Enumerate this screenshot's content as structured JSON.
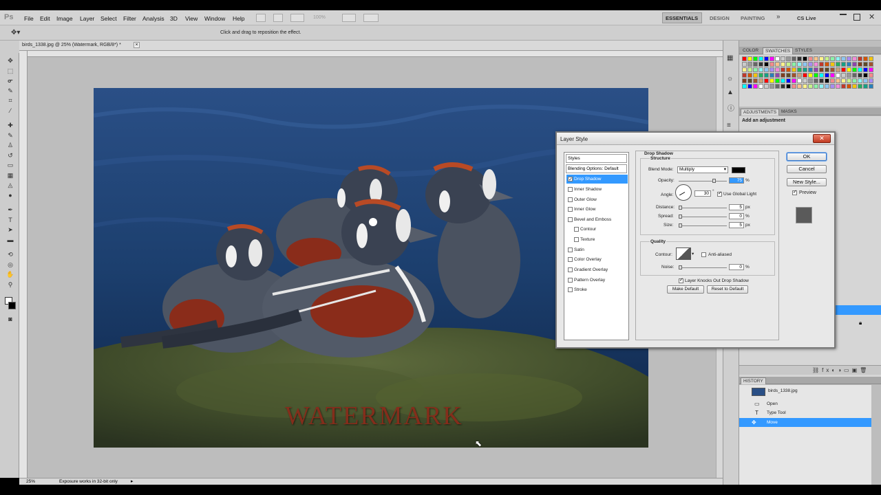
{
  "menubar": {
    "logo": "Ps",
    "items": [
      "File",
      "Edit",
      "Image",
      "Layer",
      "Select",
      "Filter",
      "Analysis",
      "3D",
      "View",
      "Window",
      "Help"
    ],
    "zoom": "100%",
    "workspaces": [
      "ESSENTIALS",
      "DESIGN",
      "PAINTING"
    ],
    "more": "»",
    "cslive": "CS Live"
  },
  "options": {
    "hint": "Click and drag to reposition the effect."
  },
  "document": {
    "tab_title": "birds_1338.jpg @ 25% (Watermark, RGB/8*) *",
    "watermark": "WATERMARK",
    "zoom": "25%",
    "status": "Exposure works in 32-bit only"
  },
  "panels": {
    "swatch_tabs": [
      "COLOR",
      "SWATCHES",
      "STYLES"
    ],
    "adjustment_tabs": [
      "ADJUSTMENTS",
      "MASKS"
    ],
    "adjustment_hint": "Add an adjustment",
    "history_tab": "HISTORY",
    "history_snapshot": "birds_1338.jpg",
    "history_items": [
      "Open",
      "Type Tool",
      "Move"
    ]
  },
  "dialog": {
    "title": "Layer Style",
    "styles_header": "Styles",
    "blending": "Blending Options: Default",
    "styles": [
      {
        "label": "Drop Shadow",
        "checked": true
      },
      {
        "label": "Inner Shadow",
        "checked": false
      },
      {
        "label": "Outer Glow",
        "checked": false
      },
      {
        "label": "Inner Glow",
        "checked": false
      },
      {
        "label": "Bevel and Emboss",
        "checked": false
      },
      {
        "label": "Contour",
        "checked": false
      },
      {
        "label": "Texture",
        "checked": false
      },
      {
        "label": "Satin",
        "checked": false
      },
      {
        "label": "Color Overlay",
        "checked": false
      },
      {
        "label": "Gradient Overlay",
        "checked": false
      },
      {
        "label": "Pattern Overlay",
        "checked": false
      },
      {
        "label": "Stroke",
        "checked": false
      }
    ],
    "section_title": "Drop Shadow",
    "structure": "Structure",
    "blend_mode_label": "Blend Mode:",
    "blend_mode": "Multiply",
    "shadow_color": "#000000",
    "opacity_label": "Opacity:",
    "opacity": "75",
    "angle_label": "Angle:",
    "angle": "30",
    "global_light": "Use Global Light",
    "distance_label": "Distance:",
    "distance": "5",
    "spread_label": "Spread:",
    "spread": "0",
    "size_label": "Size:",
    "size": "5",
    "px": "px",
    "pct": "%",
    "deg": "°",
    "quality": "Quality",
    "contour_label": "Contour:",
    "anti_aliased": "Anti-aliased",
    "noise_label": "Noise:",
    "noise": "0",
    "knockout": "Layer Knocks Out Drop Shadow",
    "make_default": "Make Default",
    "reset_default": "Reset to Default",
    "ok": "OK",
    "cancel": "Cancel",
    "new_style": "New Style...",
    "preview": "Preview"
  },
  "colors": {
    "selection": "#3399ff",
    "photo_water": "#1c3f6e",
    "watermark": "#8b2a1a"
  }
}
